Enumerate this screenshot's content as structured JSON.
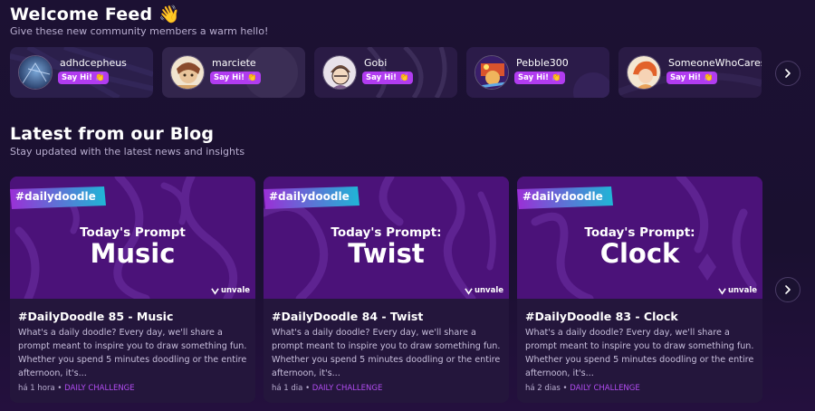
{
  "feed": {
    "title": "Welcome Feed 👋",
    "subtitle": "Give these new community members a warm hello!",
    "say_hi_label": "Say Hi! 👏",
    "members": [
      {
        "name": "adhdcepheus"
      },
      {
        "name": "marciete"
      },
      {
        "name": "Gobi"
      },
      {
        "name": "Pebble300"
      },
      {
        "name": "SomeoneWhoCares"
      }
    ],
    "next_icon": "chevron-right-icon"
  },
  "blog": {
    "title": "Latest from our Blog",
    "subtitle": "Stay updated with the latest news and insights",
    "next_icon": "chevron-right-icon",
    "posts": [
      {
        "tag": "#dailydoodle",
        "prompt_label": "Today's Prompt",
        "prompt_word": "Music",
        "brand": "unvale",
        "title": "#DailyDoodle 85 - Music",
        "excerpt": "What's a daily doodle? Every day, we'll share a prompt meant to inspire you to draw something fun. Whether you spend 5 minutes doodling or the entire afternoon, it's...",
        "time": "há 1 hora",
        "separator": "•",
        "category": "DAILY CHALLENGE"
      },
      {
        "tag": "#dailydoodle",
        "prompt_label": "Today's Prompt:",
        "prompt_word": "Twist",
        "brand": "unvale",
        "title": "#DailyDoodle 84 - Twist",
        "excerpt": "What's a daily doodle? Every day, we'll share a prompt meant to inspire you to draw something fun. Whether you spend 5 minutes doodling or the entire afternoon, it's...",
        "time": "há 1 dia",
        "separator": "•",
        "category": "DAILY CHALLENGE"
      },
      {
        "tag": "#dailydoodle",
        "prompt_label": "Today's Prompt:",
        "prompt_word": "Clock",
        "brand": "unvale",
        "title": "#DailyDoodle 83 - Clock",
        "excerpt": "What's a daily doodle? Every day, we'll share a prompt meant to inspire you to draw something fun. Whether you spend 5 minutes doodling or the entire afternoon, it's...",
        "time": "há 2 dias",
        "separator": "•",
        "category": "DAILY CHALLENGE"
      }
    ]
  },
  "colors": {
    "background": "#1c1133",
    "card": "#2a1c46",
    "accent": "#b13cf0",
    "banner": "#4a1178",
    "ribbon": "#1fb6d6"
  }
}
